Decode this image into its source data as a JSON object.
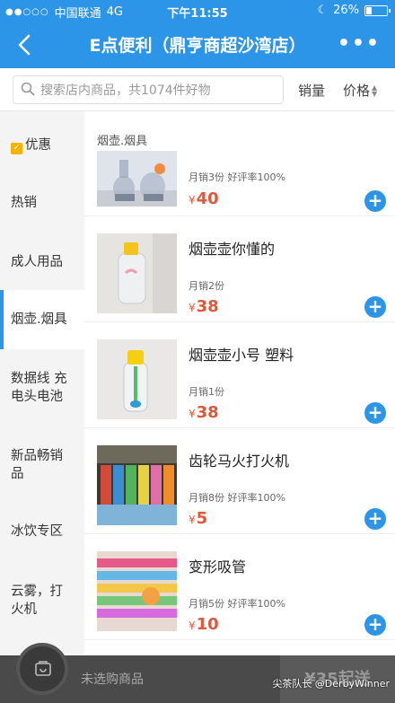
{
  "status_bar": {
    "carrier": "中国联通",
    "network": "4G",
    "time": "下午11:55",
    "battery": "26%"
  },
  "header": {
    "title": "E点便利（鼎亨商超沙湾店）"
  },
  "search": {
    "placeholder": "搜索店内商品，共1074件好物"
  },
  "sort": {
    "sales_label": "销量",
    "price_label": "价格"
  },
  "sidebar": {
    "items": [
      {
        "label": "优惠"
      },
      {
        "label": "热销"
      },
      {
        "label": "成人用品"
      },
      {
        "label": "烟壶.烟具"
      },
      {
        "label": "数据线 充电头电池"
      },
      {
        "label": "新品畅销品"
      },
      {
        "label": "冰饮专区"
      },
      {
        "label": "云雾，打火机"
      }
    ]
  },
  "section": {
    "title": "烟壶.烟具"
  },
  "products": [
    {
      "name": "",
      "sales": "月销3份",
      "rating": "好评率100%",
      "price": "40",
      "yen": "¥"
    },
    {
      "name": "烟壶壶你懂的",
      "sales": "月销2份",
      "rating": "",
      "price": "38",
      "yen": "¥"
    },
    {
      "name": "烟壶壶小号 塑料",
      "sales": "月销1份",
      "rating": "",
      "price": "38",
      "yen": "¥"
    },
    {
      "name": "齿轮马火打火机",
      "sales": "月销8份",
      "rating": "好评率100%",
      "price": "5",
      "yen": "¥"
    },
    {
      "name": "变形吸管",
      "sales": "月销5份",
      "rating": "好评率100%",
      "price": "10",
      "yen": "¥"
    }
  ],
  "bottom_bar": {
    "unselected": "未选购商品",
    "min_order": "¥35起送"
  },
  "watermark": "尖茶队长 @DerbyWinner",
  "colors": {
    "brand_blue": "#2d95e8",
    "price_red": "#e0573a"
  }
}
